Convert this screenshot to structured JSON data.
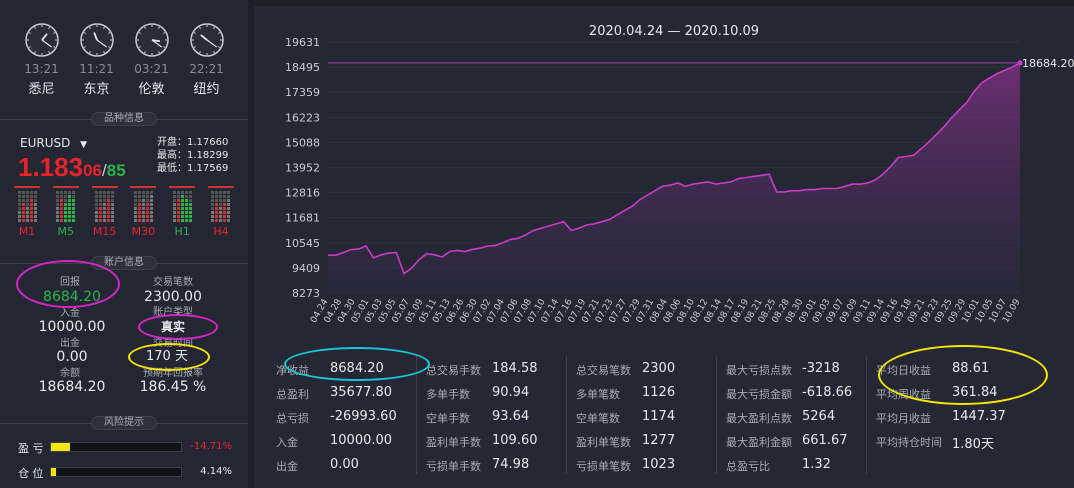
{
  "clocks": [
    {
      "time": "13:21",
      "city": "悉尼",
      "h": 1.3,
      "m": 21
    },
    {
      "time": "11:21",
      "city": "东京",
      "h": 11.3,
      "m": 21
    },
    {
      "time": "03:21",
      "city": "伦敦",
      "h": 3.3,
      "m": 21
    },
    {
      "time": "22:21",
      "city": "纽约",
      "h": 10.3,
      "m": 21
    }
  ],
  "sections": {
    "symbol_info": "品种信息",
    "account_info": "账户信息",
    "risk": "风险提示"
  },
  "symbol": {
    "name": "EURUSD",
    "price_main": "1.183",
    "price_small": "06",
    "sep": "/",
    "price_spread": "85",
    "open_label": "开盘：",
    "open": "1.17660",
    "high_label": "最高：",
    "high": "1.18299",
    "low_label": "最低：",
    "low": "1.17569"
  },
  "timeframes": [
    {
      "name": "M1",
      "color": "red"
    },
    {
      "name": "M5",
      "color": "green"
    },
    {
      "name": "M15",
      "color": "red"
    },
    {
      "name": "M30",
      "color": "red"
    },
    {
      "name": "H1",
      "color": "green"
    },
    {
      "name": "H4",
      "color": "red"
    }
  ],
  "account": {
    "return_label": "回报",
    "return_value": "8684.20",
    "trades_label": "交易笔数",
    "trades_value": "2300.00",
    "deposit_label": "入金",
    "deposit_value": "10000.00",
    "account_type_label": "账户类型",
    "account_type_value": "真实",
    "withdraw_label": "出金",
    "withdraw_value": "0.00",
    "days_label": "交易时间",
    "days_value": "170 天",
    "balance_label": "余额",
    "balance_value": "18684.20",
    "annual_label": "预期年回报率",
    "annual_value": "186.45 %"
  },
  "risk": {
    "pl_label": "盈  亏",
    "pl_value": "-14.71%",
    "pl_fill": 0.147,
    "pos_label": "仓  位",
    "pos_value": "4.14%",
    "pos_fill": 0.041
  },
  "colors": {
    "accent": "#b04fb8",
    "ring_magenta": "#d426c8",
    "ring_yellow": "#f3e600",
    "ring_cyan": "#18c8d8",
    "positive": "#2bb44a",
    "negative": "#e8232a"
  },
  "chart_data": {
    "type": "area",
    "title": "2020.04.24 — 2020.10.09",
    "y_ticks": [
      "19631",
      "18495",
      "17359",
      "16223",
      "15088",
      "13952",
      "12816",
      "11681",
      "10545",
      "9409",
      "8273"
    ],
    "ylim": [
      8273,
      19631
    ],
    "last_label": "18684.20",
    "x_labels": [
      "04.24",
      "04.28",
      "04.30",
      "05.01",
      "05.03",
      "05.05",
      "05.07",
      "05.09",
      "05.11",
      "05.13",
      "06.26",
      "06.30",
      "07.02",
      "07.04",
      "07.06",
      "07.08",
      "07.10",
      "07.14",
      "07.16",
      "07.19",
      "07.21",
      "07.23",
      "07.27",
      "07.29",
      "07.31",
      "08.04",
      "08.06",
      "08.10",
      "08.12",
      "08.14",
      "08.17",
      "08.19",
      "08.21",
      "08.25",
      "08.28",
      "08.30",
      "09.01",
      "09.03",
      "09.07",
      "09.09",
      "09.11",
      "09.14",
      "09.16",
      "09.18",
      "09.21",
      "09.23",
      "09.25",
      "09.29",
      "10.01",
      "10.05",
      "10.07",
      "10.09"
    ],
    "values": [
      9990,
      9980,
      10100,
      10240,
      10260,
      10400,
      9860,
      10000,
      10080,
      10100,
      9150,
      9400,
      9800,
      10050,
      10000,
      9900,
      10150,
      10200,
      10150,
      10250,
      10300,
      10400,
      10420,
      10550,
      10700,
      10750,
      10900,
      11100,
      11200,
      11300,
      11400,
      11500,
      11100,
      11200,
      11350,
      11400,
      11500,
      11600,
      11800,
      12000,
      12200,
      12500,
      12700,
      12900,
      13100,
      13150,
      13250,
      13100,
      13200,
      13250,
      13300,
      13200,
      13250,
      13300,
      13450,
      13500,
      13550,
      13600,
      13650,
      12850,
      12850,
      12900,
      12900,
      12950,
      12950,
      13000,
      13000,
      13000,
      13100,
      13200,
      13200,
      13250,
      13400,
      13650,
      14000,
      14400,
      14450,
      14500,
      14800,
      15100,
      15450,
      15800,
      16200,
      16550,
      16900,
      17400,
      17800,
      18000,
      18200,
      18350,
      18500,
      18684
    ]
  },
  "stats": [
    [
      {
        "k": "净收益",
        "v": "8684.20"
      },
      {
        "k": "总盈利",
        "v": "35677.80"
      },
      {
        "k": "总亏损",
        "v": "-26993.60"
      },
      {
        "k": "入金",
        "v": "10000.00"
      },
      {
        "k": "出金",
        "v": "0.00"
      }
    ],
    [
      {
        "k": "总交易手数",
        "v": "184.58"
      },
      {
        "k": "多单手数",
        "v": "90.94"
      },
      {
        "k": "空单手数",
        "v": "93.64"
      },
      {
        "k": "盈利单手数",
        "v": "109.60"
      },
      {
        "k": "亏损单手数",
        "v": "74.98"
      }
    ],
    [
      {
        "k": "总交易笔数",
        "v": "2300"
      },
      {
        "k": "多单笔数",
        "v": "1126"
      },
      {
        "k": "空单笔数",
        "v": "1174"
      },
      {
        "k": "盈利单笔数",
        "v": "1277"
      },
      {
        "k": "亏损单笔数",
        "v": "1023"
      }
    ],
    [
      {
        "k": "最大亏损点数",
        "v": "-3218"
      },
      {
        "k": "最大亏损金额",
        "v": "-618.66"
      },
      {
        "k": "最大盈利点数",
        "v": "5264"
      },
      {
        "k": "最大盈利金额",
        "v": "661.67"
      },
      {
        "k": "总盈亏比",
        "v": "1.32"
      }
    ],
    [
      {
        "k": "平均日收益",
        "v": "88.61"
      },
      {
        "k": "平均周收益",
        "v": "361.84"
      },
      {
        "k": "平均月收益",
        "v": "1447.37"
      },
      {
        "k": "平均持仓时间",
        "v": "1.80天"
      }
    ]
  ]
}
